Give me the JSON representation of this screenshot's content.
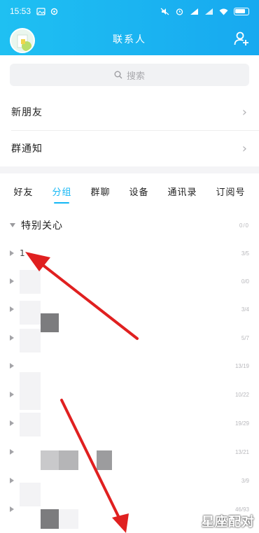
{
  "status_bar": {
    "time": "15:53",
    "battery": "86"
  },
  "header": {
    "title": "联系人"
  },
  "search": {
    "placeholder": "搜索"
  },
  "menu_rows": [
    {
      "label": "新朋友"
    },
    {
      "label": "群通知"
    }
  ],
  "tabs": [
    {
      "label": "好友",
      "active": false
    },
    {
      "label": "分组",
      "active": true
    },
    {
      "label": "群聊",
      "active": false
    },
    {
      "label": "设备",
      "active": false
    },
    {
      "label": "通讯录",
      "active": false
    },
    {
      "label": "订阅号",
      "active": false
    }
  ],
  "special_group": {
    "label": "特别关心",
    "count": "0/0"
  },
  "groups": [
    {
      "name": "1",
      "count": "3/5"
    },
    {
      "name": "",
      "count": "0/0"
    },
    {
      "name": "",
      "count": "3/4"
    },
    {
      "name": "",
      "count": "5/7"
    },
    {
      "name": "",
      "count": "13/19"
    },
    {
      "name": "",
      "count": "10/22"
    },
    {
      "name": "",
      "count": "19/29"
    },
    {
      "name": "",
      "count": "13/21"
    },
    {
      "name": "",
      "count": "3/9"
    },
    {
      "name": "",
      "count": "46/93"
    }
  ],
  "watermark": "星座配对",
  "colors": {
    "accent": "#12b7f5",
    "header_start": "#1fc0f2",
    "header_end": "#17a9f0",
    "arrow": "#e02020"
  },
  "icons": {
    "search": "search-icon",
    "add_contact": "add-contact-icon",
    "chevron": "chevron-right-icon",
    "avatar": "avatar"
  }
}
